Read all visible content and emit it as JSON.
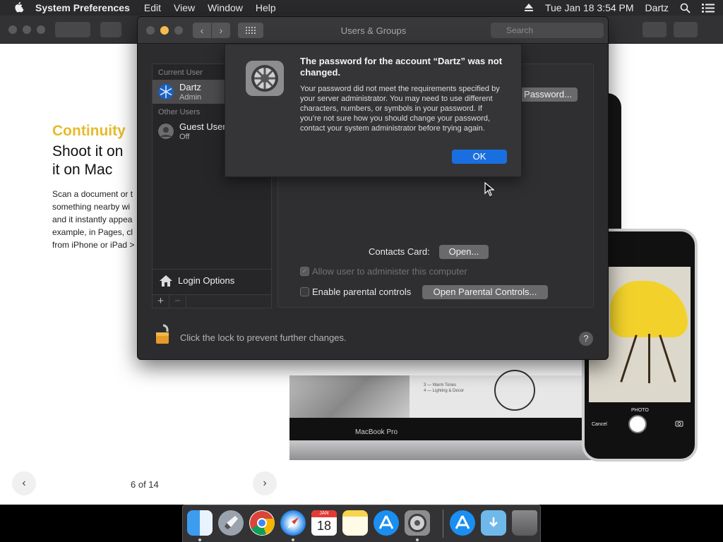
{
  "menubar": {
    "app_name": "System Preferences",
    "items": [
      "Edit",
      "View",
      "Window",
      "Help"
    ],
    "clock": "Tue Jan 18  3:54 PM",
    "user": "Dartz"
  },
  "book": {
    "heading_accent": "Continuity",
    "heading_line1": "Shoot it on",
    "heading_line2": "it on Mac",
    "paragraph": [
      "Scan a document or t",
      "something nearby wi",
      "and it instantly appea",
      "example, in Pages, cl",
      "from iPhone or iPad >"
    ],
    "page_counter": "6 of 14",
    "laptop_label": "MacBook Pro",
    "screen_list": [
      "3 — Warm Tones",
      "4 — Lighting & Decor"
    ],
    "camera_mode": "PHOTO",
    "camera_cancel": "Cancel"
  },
  "users_window": {
    "title": "Users & Groups",
    "search_placeholder": "Search",
    "current_user_label": "Current User",
    "current_user": {
      "name": "Dartz",
      "role": "Admin"
    },
    "other_users_label": "Other Users",
    "other_user": {
      "name": "Guest User",
      "role": "Off"
    },
    "login_options": "Login Options",
    "plus": "+",
    "minus": "−",
    "password_button": "Password...",
    "contacts_label": "Contacts Card:",
    "open_button": "Open...",
    "allow_admin": "Allow user to administer this computer",
    "parental_label": "Enable parental controls",
    "parental_button": "Open Parental Controls...",
    "lock_text": "Click the lock to prevent further changes.",
    "help": "?"
  },
  "alert": {
    "title": "The password for the account “Dartz” was not changed.",
    "message": "Your password did not meet the requirements specified by your server administrator. You may need to use different characters, numbers, or symbols in your password. If you’re not sure how you should change your password, contact your system administrator before trying again.",
    "ok_label": "OK"
  },
  "dock": {
    "apps": [
      "finder-icon",
      "launchpad-icon",
      "chrome-icon",
      "safari-icon",
      "calendar-icon",
      "notes-icon",
      "app-store-icon",
      "system-preferences-icon",
      "app-store-downloads-icon",
      "downloads-folder-icon",
      "trash-icon"
    ],
    "calendar_month": "JAN",
    "calendar_day": "18"
  },
  "colors": {
    "accent_blue": "#1a6fe0",
    "continuity_yellow": "#e6bb2c"
  }
}
